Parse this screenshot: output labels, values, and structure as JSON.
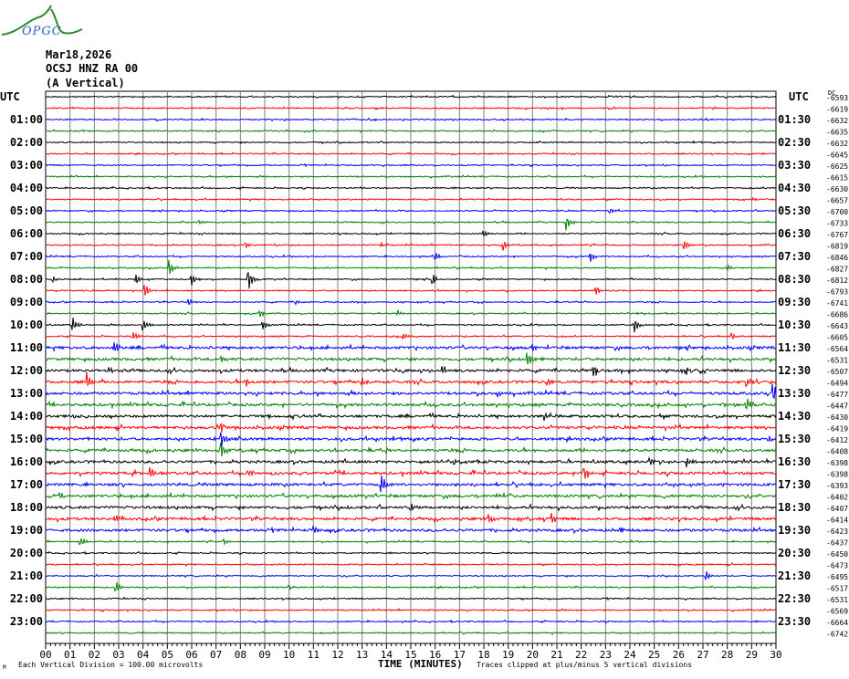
{
  "logo": {
    "text": "OPGC"
  },
  "header": {
    "date": "Mar18,2026",
    "station": "OCSJ HNZ RA 00",
    "component": "(A Vertical)"
  },
  "colors": {
    "trace_cycle": [
      "#000000",
      "#ff0000",
      "#0000ff",
      "#008000"
    ],
    "grid": "#808080"
  },
  "footer": {
    "corner_mark": "M",
    "scale": "Each Vertical Division =  100.00 microvolts",
    "xlabel": "TIME (MINUTES)",
    "clip_note": "Traces clipped at plus/minus 5 vertical divisions"
  },
  "chart_data": {
    "type": "line",
    "title": "Mar18,2026 OCSJ HNZ RA 00 (A Vertical)",
    "xlabel": "TIME (MINUTES)",
    "xlim": [
      0,
      30
    ],
    "x_ticks": [
      "00",
      "01",
      "02",
      "03",
      "04",
      "05",
      "06",
      "07",
      "08",
      "09",
      "10",
      "11",
      "12",
      "13",
      "14",
      "15",
      "16",
      "17",
      "18",
      "19",
      "20",
      "21",
      "22",
      "23",
      "24",
      "25",
      "26",
      "27",
      "28",
      "29",
      "30"
    ],
    "left_axis_title": "UTC",
    "right_axis_title": "UTC",
    "right_header": "DC",
    "left_labels": [
      "",
      "01:00",
      "02:00",
      "03:00",
      "04:00",
      "05:00",
      "06:00",
      "07:00",
      "08:00",
      "09:00",
      "10:00",
      "11:00",
      "12:00",
      "13:00",
      "14:00",
      "15:00",
      "16:00",
      "17:00",
      "18:00",
      "19:00",
      "20:00",
      "21:00",
      "22:00",
      "23:00"
    ],
    "right_labels": [
      "",
      "01:30",
      "02:30",
      "03:30",
      "04:30",
      "05:30",
      "06:30",
      "07:30",
      "08:30",
      "09:30",
      "10:30",
      "11:30",
      "12:30",
      "13:30",
      "14:30",
      "15:30",
      "16:30",
      "17:30",
      "18:30",
      "19:30",
      "20:30",
      "21:30",
      "22:30",
      "23:30"
    ],
    "dc_offsets": [
      -6593,
      -6619,
      -6632,
      -6635,
      -6632,
      -6645,
      -6625,
      -6615,
      -6630,
      -6657,
      -6700,
      -6733,
      -6767,
      -6819,
      -6846,
      -6827,
      -6812,
      -6793,
      -6741,
      -6686,
      -6643,
      -6605,
      -6564,
      -6531,
      -6507,
      -6494,
      -6477,
      -6447,
      -6430,
      -6419,
      -6412,
      -6408,
      -6398,
      -6398,
      -6393,
      -6402,
      -6407,
      -6414,
      -6423,
      -6437,
      -6450,
      -6473,
      -6495,
      -6517,
      -6531,
      -6569,
      -6664,
      -6742
    ],
    "events": [
      {
        "trace": 10,
        "minute": 23.2,
        "amp": 3
      },
      {
        "trace": 11,
        "minute": 6.3,
        "amp": 3
      },
      {
        "trace": 11,
        "minute": 21.4,
        "amp": 10
      },
      {
        "trace": 12,
        "minute": 18.0,
        "amp": 5
      },
      {
        "trace": 13,
        "minute": 8.2,
        "amp": 4
      },
      {
        "trace": 13,
        "minute": 13.8,
        "amp": 3
      },
      {
        "trace": 13,
        "minute": 18.8,
        "amp": 8
      },
      {
        "trace": 13,
        "minute": 26.2,
        "amp": 8
      },
      {
        "trace": 14,
        "minute": 16.0,
        "amp": 6
      },
      {
        "trace": 14,
        "minute": 22.4,
        "amp": 6
      },
      {
        "trace": 15,
        "minute": 5.1,
        "amp": 10
      },
      {
        "trace": 15,
        "minute": 28.0,
        "amp": 4
      },
      {
        "trace": 16,
        "minute": 8.3,
        "amp": 18
      },
      {
        "trace": 16,
        "minute": 15.9,
        "amp": 10
      },
      {
        "trace": 16,
        "minute": 6.0,
        "amp": 8
      },
      {
        "trace": 16,
        "minute": 3.7,
        "amp": 7
      },
      {
        "trace": 16,
        "minute": 0.3,
        "amp": 5
      },
      {
        "trace": 17,
        "minute": 4.1,
        "amp": 8
      },
      {
        "trace": 17,
        "minute": 22.6,
        "amp": 8
      },
      {
        "trace": 18,
        "minute": 5.9,
        "amp": 4
      },
      {
        "trace": 18,
        "minute": 10.3,
        "amp": 3
      },
      {
        "trace": 19,
        "minute": 8.8,
        "amp": 5
      },
      {
        "trace": 19,
        "minute": 14.5,
        "amp": 4
      },
      {
        "trace": 20,
        "minute": 1.1,
        "amp": 10
      },
      {
        "trace": 20,
        "minute": 4.0,
        "amp": 8
      },
      {
        "trace": 20,
        "minute": 8.9,
        "amp": 7
      },
      {
        "trace": 20,
        "minute": 24.2,
        "amp": 9
      },
      {
        "trace": 21,
        "minute": 3.6,
        "amp": 6
      },
      {
        "trace": 21,
        "minute": 14.7,
        "amp": 5
      },
      {
        "trace": 21,
        "minute": 28.2,
        "amp": 5
      },
      {
        "trace": 22,
        "minute": 2.8,
        "amp": 10
      },
      {
        "trace": 22,
        "minute": 20.0,
        "amp": 7
      },
      {
        "trace": 23,
        "minute": 19.8,
        "amp": 12
      },
      {
        "trace": 23,
        "minute": 7.2,
        "amp": 6
      },
      {
        "trace": 24,
        "minute": 2.6,
        "amp": 5
      },
      {
        "trace": 24,
        "minute": 16.3,
        "amp": 6
      },
      {
        "trace": 24,
        "minute": 22.5,
        "amp": 8
      },
      {
        "trace": 24,
        "minute": 26.3,
        "amp": 8
      },
      {
        "trace": 25,
        "minute": 1.7,
        "amp": 14
      },
      {
        "trace": 25,
        "minute": 8.2,
        "amp": 6
      },
      {
        "trace": 25,
        "minute": 13.0,
        "amp": 5
      },
      {
        "trace": 25,
        "minute": 20.6,
        "amp": 7
      },
      {
        "trace": 25,
        "minute": 28.8,
        "amp": 6
      },
      {
        "trace": 26,
        "minute": 18.6,
        "amp": 5
      },
      {
        "trace": 26,
        "minute": 29.9,
        "amp": 12
      },
      {
        "trace": 27,
        "minute": 28.8,
        "amp": 9
      },
      {
        "trace": 28,
        "minute": 1.2,
        "amp": 4
      },
      {
        "trace": 28,
        "minute": 20.5,
        "amp": 6
      },
      {
        "trace": 29,
        "minute": 7.2,
        "amp": 8
      },
      {
        "trace": 30,
        "minute": 7.2,
        "amp": 12
      },
      {
        "trace": 30,
        "minute": 29.7,
        "amp": 5
      },
      {
        "trace": 31,
        "minute": 7.2,
        "amp": 14
      },
      {
        "trace": 31,
        "minute": 14.0,
        "amp": 4
      },
      {
        "trace": 32,
        "minute": 16.8,
        "amp": 7
      },
      {
        "trace": 32,
        "minute": 26.3,
        "amp": 8
      },
      {
        "trace": 32,
        "minute": 24.8,
        "amp": 6
      },
      {
        "trace": 33,
        "minute": 4.3,
        "amp": 8
      },
      {
        "trace": 33,
        "minute": 22.1,
        "amp": 12
      },
      {
        "trace": 33,
        "minute": 8.3,
        "amp": 6
      },
      {
        "trace": 34,
        "minute": 13.8,
        "amp": 16
      },
      {
        "trace": 35,
        "minute": 0.6,
        "amp": 5
      },
      {
        "trace": 35,
        "minute": 18.5,
        "amp": 4
      },
      {
        "trace": 36,
        "minute": 15.0,
        "amp": 6
      },
      {
        "trace": 37,
        "minute": 20.8,
        "amp": 7
      },
      {
        "trace": 37,
        "minute": 2.8,
        "amp": 5
      },
      {
        "trace": 37,
        "minute": 18.2,
        "amp": 6
      },
      {
        "trace": 38,
        "minute": 11.0,
        "amp": 5
      },
      {
        "trace": 38,
        "minute": 23.6,
        "amp": 4
      },
      {
        "trace": 39,
        "minute": 1.4,
        "amp": 8
      },
      {
        "trace": 39,
        "minute": 7.3,
        "amp": 5
      },
      {
        "trace": 42,
        "minute": 27.1,
        "amp": 8
      },
      {
        "trace": 43,
        "minute": 2.9,
        "amp": 7
      },
      {
        "trace": 43,
        "minute": 10.0,
        "amp": 4
      },
      {
        "trace": 9,
        "minute": 29.0,
        "amp": 3
      }
    ]
  }
}
